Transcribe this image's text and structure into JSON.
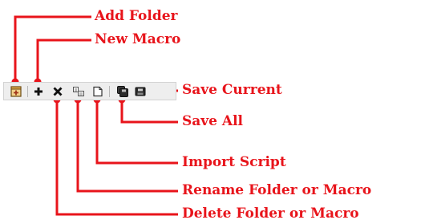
{
  "annotations": {
    "add_folder": "Add Folder",
    "new_macro": "New Macro",
    "save_current": "Save Current",
    "save_all": "Save All",
    "import_script": "Import Script",
    "rename": "Rename Folder or Macro",
    "delete": "Delete Folder or Macro"
  },
  "toolbar": {
    "buttons": [
      {
        "action": "add-folder",
        "icon": "folder-add-icon"
      },
      {
        "action": "new-macro",
        "icon": "plus-icon"
      },
      {
        "action": "delete",
        "icon": "x-icon"
      },
      {
        "action": "rename",
        "icon": "rename-icon"
      },
      {
        "action": "import-script",
        "icon": "import-icon"
      },
      {
        "action": "save-all",
        "icon": "save-all-icon"
      },
      {
        "action": "save-current",
        "icon": "save-icon"
      }
    ]
  },
  "colors": {
    "annotation": "#e8141b",
    "toolbar_bg": "#eeeeee",
    "toolbar_border": "#d2d2d2"
  }
}
